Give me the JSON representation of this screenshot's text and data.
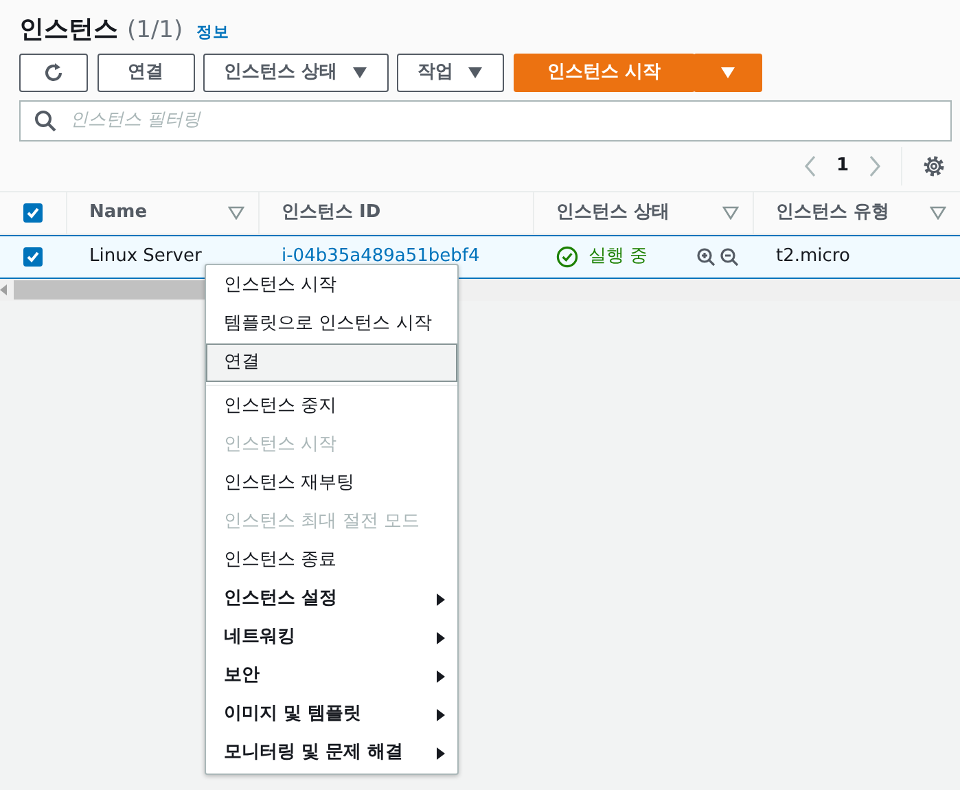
{
  "header": {
    "title": "인스턴스",
    "count": "(1/1)",
    "info_link": "정보"
  },
  "toolbar": {
    "buttons": [
      {
        "kind": "refresh"
      },
      {
        "kind": "plain",
        "label": "연결"
      },
      {
        "kind": "dropdown",
        "label": "인스턴스 상태"
      },
      {
        "kind": "dropdown",
        "label": "작업"
      },
      {
        "kind": "primary",
        "label": "인스턴스 시작"
      },
      {
        "kind": "primary-caret"
      }
    ]
  },
  "search": {
    "placeholder": "인스턴스 필터링"
  },
  "pagination": {
    "page": "1"
  },
  "table": {
    "select_all_checked": true,
    "columns": [
      {
        "label": "Name"
      },
      {
        "label": "인스턴스 ID"
      },
      {
        "label": "인스턴스 상태"
      },
      {
        "label": "인스턴스 유형"
      }
    ],
    "rows": [
      {
        "selected": true,
        "name": "Linux Server",
        "instance_id": "i-04b35a489a51bebf4",
        "state": "실행 중",
        "type": "t2.micro"
      }
    ]
  },
  "context_menu": [
    {
      "label": "인스턴스 시작",
      "kind": "action",
      "disabled": false,
      "highlighted": false,
      "divider_after": false
    },
    {
      "label": "템플릿으로 인스턴스 시작",
      "kind": "action",
      "disabled": false,
      "highlighted": false,
      "divider_after": false
    },
    {
      "label": "연결",
      "kind": "action",
      "disabled": false,
      "highlighted": true,
      "divider_after": true
    },
    {
      "label": "인스턴스 중지",
      "kind": "action",
      "disabled": false,
      "highlighted": false,
      "divider_after": false
    },
    {
      "label": "인스턴스 시작",
      "kind": "action",
      "disabled": true,
      "highlighted": false,
      "divider_after": false
    },
    {
      "label": "인스턴스 재부팅",
      "kind": "action",
      "disabled": false,
      "highlighted": false,
      "divider_after": false
    },
    {
      "label": "인스턴스 최대 절전 모드",
      "kind": "action",
      "disabled": true,
      "highlighted": false,
      "divider_after": false
    },
    {
      "label": "인스턴스 종료",
      "kind": "action",
      "disabled": false,
      "highlighted": false,
      "divider_after": false
    },
    {
      "label": "인스턴스 설정",
      "kind": "submenu",
      "disabled": false,
      "highlighted": false,
      "divider_after": false
    },
    {
      "label": "네트워킹",
      "kind": "submenu",
      "disabled": false,
      "highlighted": false,
      "divider_after": false
    },
    {
      "label": "보안",
      "kind": "submenu",
      "disabled": false,
      "highlighted": false,
      "divider_after": false
    },
    {
      "label": "이미지 및 템플릿",
      "kind": "submenu",
      "disabled": false,
      "highlighted": false,
      "divider_after": false
    },
    {
      "label": "모니터링 및 문제 해결",
      "kind": "submenu",
      "disabled": false,
      "highlighted": false,
      "divider_after": false
    }
  ]
}
